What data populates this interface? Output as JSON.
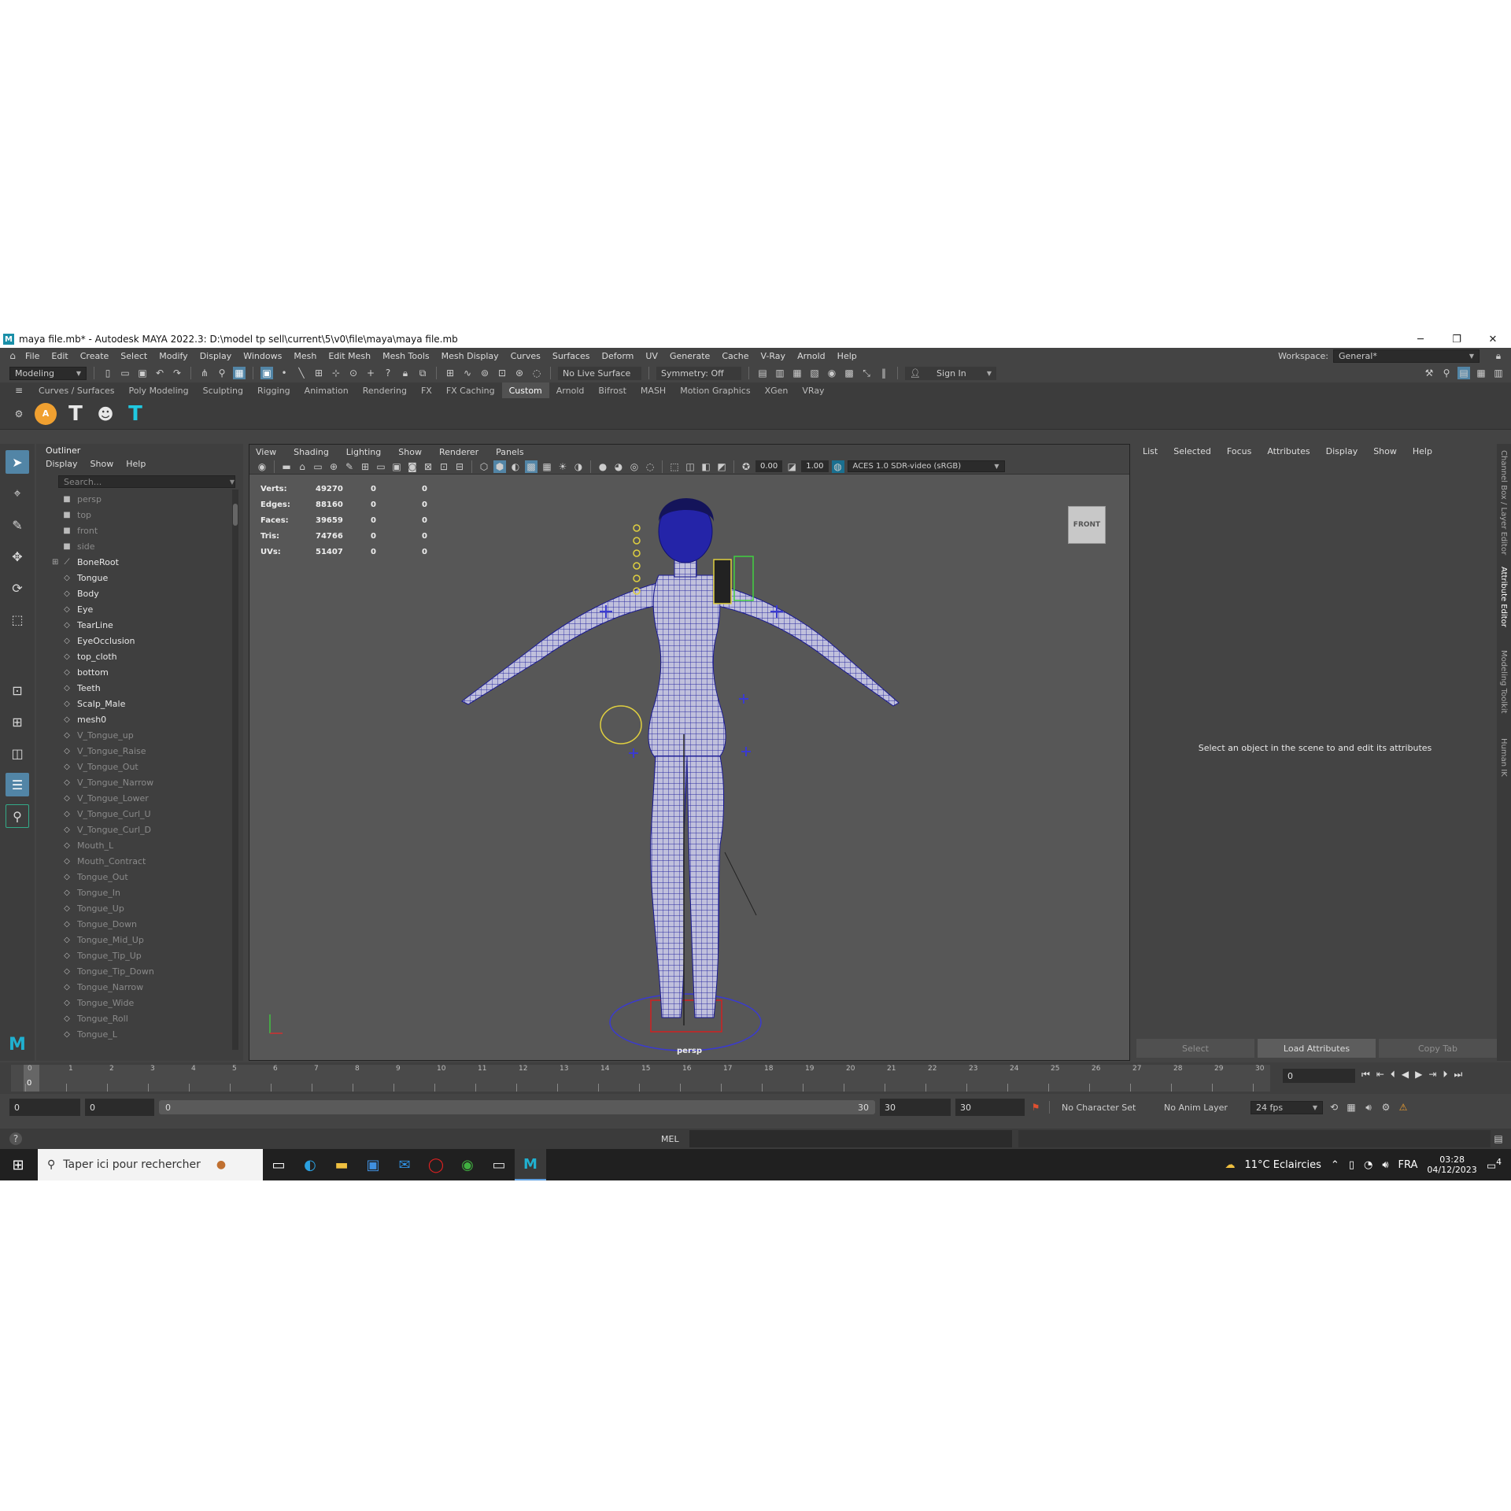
{
  "window": {
    "title": "maya file.mb* - Autodesk MAYA 2022.3: D:\\model tp sell\\current\\5\\v0\\file\\maya\\maya file.mb",
    "logo": "M"
  },
  "menubar": {
    "items": [
      "File",
      "Edit",
      "Create",
      "Select",
      "Modify",
      "Display",
      "Windows",
      "Mesh",
      "Edit Mesh",
      "Mesh Tools",
      "Mesh Display",
      "Curves",
      "Surfaces",
      "Deform",
      "UV",
      "Generate",
      "Cache",
      "V-Ray",
      "Arnold",
      "Help"
    ],
    "workspace_label": "Workspace:",
    "workspace_value": "General*"
  },
  "statusbar": {
    "mode": "Modeling",
    "live_surface": "No Live Surface",
    "symmetry": "Symmetry: Off",
    "sign_in": "Sign In"
  },
  "shelf": {
    "tabs": [
      "Curves / Surfaces",
      "Poly Modeling",
      "Sculpting",
      "Rigging",
      "Animation",
      "Rendering",
      "FX",
      "FX Caching",
      "Custom",
      "Arnold",
      "Bifrost",
      "MASH",
      "Motion Graphics",
      "XGen",
      "VRay"
    ],
    "active_tab": "Custom",
    "buttons": [
      {
        "icon": "arnold-a-icon",
        "glyph": "A",
        "color": "#f0a030"
      },
      {
        "icon": "t-pose-icon",
        "glyph": "T",
        "color": "#e8e8e8"
      },
      {
        "icon": "skull-icon",
        "glyph": "☻",
        "color": "#e8e8e8"
      },
      {
        "icon": "t-pose-cyan-icon",
        "glyph": "T",
        "color": "#20c8e0"
      }
    ]
  },
  "outliner": {
    "title": "Outliner",
    "menu": [
      "Display",
      "Show",
      "Help"
    ],
    "search_placeholder": "Search...",
    "items": [
      {
        "label": "persp",
        "type": "camera",
        "dim": true
      },
      {
        "label": "top",
        "type": "camera",
        "dim": true
      },
      {
        "label": "front",
        "type": "camera",
        "dim": true
      },
      {
        "label": "side",
        "type": "camera",
        "dim": true
      },
      {
        "label": "BoneRoot",
        "type": "joint",
        "dim": false,
        "expand": true
      },
      {
        "label": "Tongue",
        "type": "mesh",
        "dim": false
      },
      {
        "label": "Body",
        "type": "mesh",
        "dim": false
      },
      {
        "label": "Eye",
        "type": "mesh",
        "dim": false
      },
      {
        "label": "TearLine",
        "type": "mesh",
        "dim": false
      },
      {
        "label": "EyeOcclusion",
        "type": "mesh",
        "dim": false
      },
      {
        "label": "top_cloth",
        "type": "mesh",
        "dim": false
      },
      {
        "label": "bottom",
        "type": "mesh",
        "dim": false
      },
      {
        "label": "Teeth",
        "type": "mesh",
        "dim": false
      },
      {
        "label": "Scalp_Male",
        "type": "mesh",
        "dim": false
      },
      {
        "label": "mesh0",
        "type": "mesh",
        "dim": false
      },
      {
        "label": "V_Tongue_up",
        "type": "mesh",
        "dim": true
      },
      {
        "label": "V_Tongue_Raise",
        "type": "mesh",
        "dim": true
      },
      {
        "label": "V_Tongue_Out",
        "type": "mesh",
        "dim": true
      },
      {
        "label": "V_Tongue_Narrow",
        "type": "mesh",
        "dim": true
      },
      {
        "label": "V_Tongue_Lower",
        "type": "mesh",
        "dim": true
      },
      {
        "label": "V_Tongue_Curl_U",
        "type": "mesh",
        "dim": true
      },
      {
        "label": "V_Tongue_Curl_D",
        "type": "mesh",
        "dim": true
      },
      {
        "label": "Mouth_L",
        "type": "mesh",
        "dim": true
      },
      {
        "label": "Mouth_Contract",
        "type": "mesh",
        "dim": true
      },
      {
        "label": "Tongue_Out",
        "type": "mesh",
        "dim": true
      },
      {
        "label": "Tongue_In",
        "type": "mesh",
        "dim": true
      },
      {
        "label": "Tongue_Up",
        "type": "mesh",
        "dim": true
      },
      {
        "label": "Tongue_Down",
        "type": "mesh",
        "dim": true
      },
      {
        "label": "Tongue_Mid_Up",
        "type": "mesh",
        "dim": true
      },
      {
        "label": "Tongue_Tip_Up",
        "type": "mesh",
        "dim": true
      },
      {
        "label": "Tongue_Tip_Down",
        "type": "mesh",
        "dim": true
      },
      {
        "label": "Tongue_Narrow",
        "type": "mesh",
        "dim": true
      },
      {
        "label": "Tongue_Wide",
        "type": "mesh",
        "dim": true
      },
      {
        "label": "Tongue_Roll",
        "type": "mesh",
        "dim": true
      },
      {
        "label": "Tongue_L",
        "type": "mesh",
        "dim": true
      }
    ]
  },
  "viewport": {
    "menu": [
      "View",
      "Shading",
      "Lighting",
      "Show",
      "Renderer",
      "Panels"
    ],
    "exposure": "0.00",
    "gamma": "1.00",
    "color_space": "ACES 1.0 SDR-video (sRGB)",
    "hud": [
      {
        "label": "Verts:",
        "value": "49270",
        "a": "0",
        "b": "0"
      },
      {
        "label": "Edges:",
        "value": "88160",
        "a": "0",
        "b": "0"
      },
      {
        "label": "Faces:",
        "value": "39659",
        "a": "0",
        "b": "0"
      },
      {
        "label": "Tris:",
        "value": "74766",
        "a": "0",
        "b": "0"
      },
      {
        "label": "UVs:",
        "value": "51407",
        "a": "0",
        "b": "0"
      }
    ],
    "viewcube": "FRONT",
    "camera": "persp"
  },
  "attribute_editor": {
    "menu": [
      "List",
      "Selected",
      "Focus",
      "Attributes",
      "Display",
      "Show",
      "Help"
    ],
    "message": "Select an object in the scene to and edit its attributes",
    "buttons": [
      "Select",
      "Load Attributes",
      "Copy Tab"
    ],
    "side_tabs": [
      "Channel Box / Layer Editor",
      "Attribute Editor",
      "Modeling Toolkit",
      "Human IK"
    ]
  },
  "timeline": {
    "ticks": [
      "0",
      "1",
      "2",
      "3",
      "4",
      "5",
      "6",
      "7",
      "8",
      "9",
      "10",
      "11",
      "12",
      "13",
      "14",
      "15",
      "16",
      "17",
      "18",
      "19",
      "20",
      "21",
      "22",
      "23",
      "24",
      "25",
      "26",
      "27",
      "28",
      "29",
      "30"
    ],
    "current_frame_marker": "0",
    "current_frame": "0"
  },
  "range": {
    "start": "0",
    "anim_start": "0",
    "slider_start": "0",
    "slider_end": "30",
    "end": "30",
    "anim_end": "30",
    "character_set": "No Character Set",
    "anim_layer": "No Anim Layer",
    "fps": "24 fps"
  },
  "cmdline": {
    "lang": "MEL"
  },
  "taskbar": {
    "search_placeholder": "Taper ici pour rechercher",
    "weather": "11°C  Eclaircies",
    "lang": "FRA",
    "time": "03:28",
    "date": "04/12/2023",
    "notif_count": "4"
  },
  "colors": {
    "accent": "#5285a6",
    "wire": "#2020a0",
    "mesh": "#b8b8d8"
  }
}
